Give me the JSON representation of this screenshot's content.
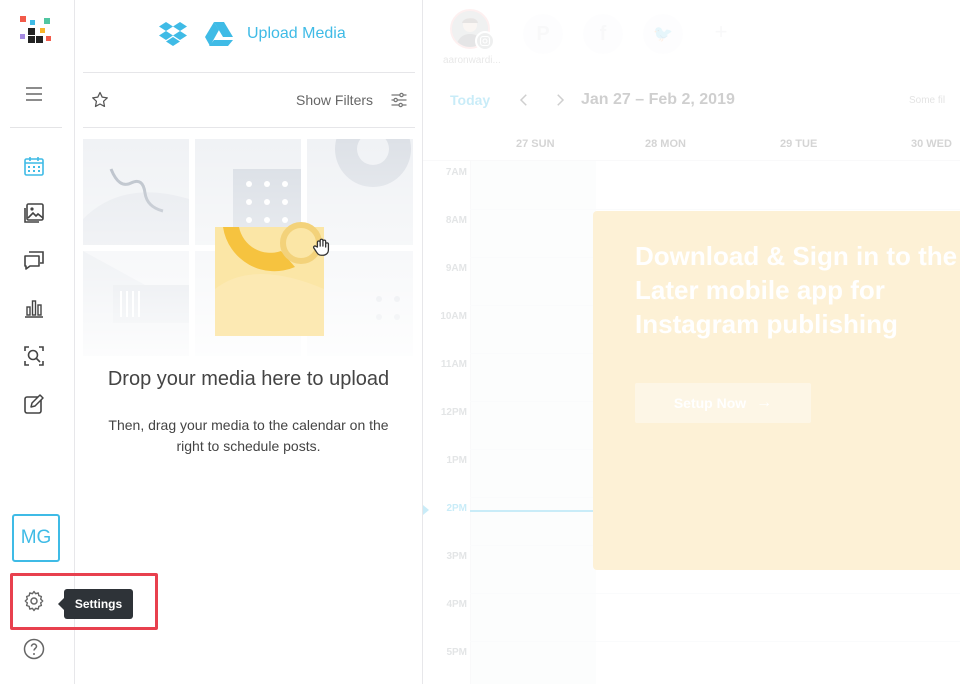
{
  "media": {
    "upload_label": "Upload Media",
    "show_filters": "Show Filters",
    "drop_title": "Drop your media here to upload",
    "drop_subtitle_line1": "Then, drag your media to the calendar on the",
    "drop_subtitle_line2": "right to schedule posts."
  },
  "profile": {
    "username": "aaronwardi..."
  },
  "nav": {
    "workspace_initials": "MG",
    "settings_tooltip": "Settings"
  },
  "calendar": {
    "today_label": "Today",
    "date_range": "Jan 27 – Feb 2, 2019",
    "days": [
      "27 SUN",
      "28 MON",
      "29 TUE",
      "30 WED"
    ],
    "hours": [
      "7AM",
      "8AM",
      "9AM",
      "10AM",
      "11AM",
      "12PM",
      "1PM",
      "2PM",
      "3PM",
      "4PM",
      "5PM"
    ],
    "top_right": "Some fil"
  },
  "promo": {
    "line1": "Download & Sign in to the",
    "line2": "Later mobile app for",
    "line3": "Instagram publishing",
    "button": "Setup Now"
  },
  "colors": {
    "accent": "#3fbbe6",
    "highlight": "#e8404e",
    "tooltip_bg": "#2e3338"
  }
}
